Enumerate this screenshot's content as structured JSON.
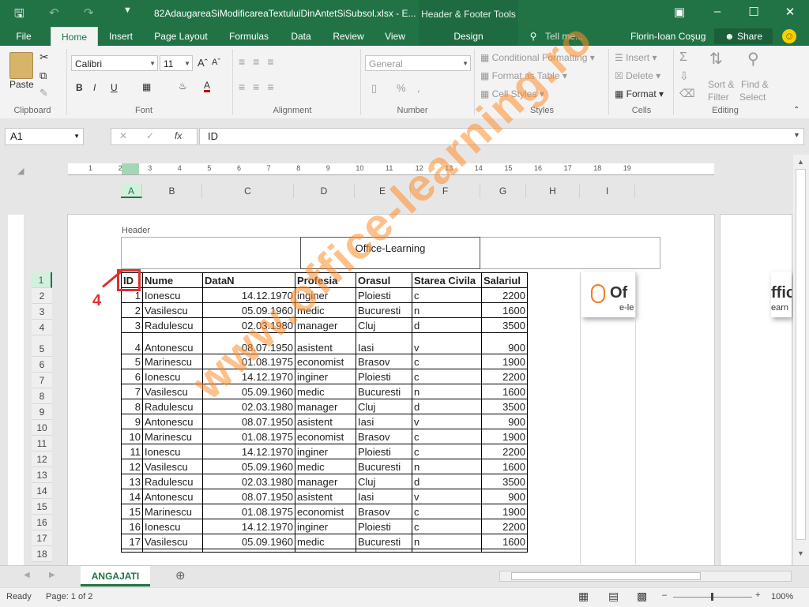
{
  "titlebar": {
    "document_title": "82AdaugareaSiModificareaTextuluiDinAntetSiSubsol.xlsx - E...",
    "context_tools": "Header & Footer Tools"
  },
  "tabs": [
    {
      "label": "File"
    },
    {
      "label": "Home"
    },
    {
      "label": "Insert"
    },
    {
      "label": "Page Layout"
    },
    {
      "label": "Formulas"
    },
    {
      "label": "Data"
    },
    {
      "label": "Review"
    },
    {
      "label": "View"
    },
    {
      "label": "Design"
    },
    {
      "label": "Tell me..."
    }
  ],
  "user": {
    "name": "Florin-Ioan Coşug",
    "share_label": "Share"
  },
  "ribbon": {
    "clipboard": {
      "paste": "Paste",
      "label": "Clipboard"
    },
    "font": {
      "name": "Calibri",
      "size": "11",
      "label": "Font"
    },
    "alignment": {
      "label": "Alignment"
    },
    "number": {
      "format": "General",
      "label": "Number"
    },
    "styles": {
      "conditional": "Conditional Formatting",
      "format_table": "Format as Table",
      "cell_styles": "Cell Styles",
      "label": "Styles"
    },
    "cells": {
      "insert": "Insert",
      "delete": "Delete",
      "format": "Format",
      "label": "Cells"
    },
    "editing": {
      "sort1": "Sort &",
      "sort2": "Filter",
      "find1": "Find &",
      "find2": "Select",
      "label": "Editing"
    }
  },
  "formula_bar": {
    "name_box": "A1",
    "formula": "ID"
  },
  "columns": [
    "A",
    "B",
    "C",
    "D",
    "E",
    "F",
    "G",
    "H",
    "I"
  ],
  "ruler_numbers": [
    "1",
    "2",
    "3",
    "4",
    "5",
    "6",
    "7",
    "8",
    "9",
    "10",
    "11",
    "12",
    "13",
    "14",
    "15",
    "16",
    "17",
    "18",
    "19"
  ],
  "header_area": {
    "label": "Header",
    "center_text": "Office-Learning"
  },
  "table": {
    "headers": [
      "ID",
      "Nume",
      "DataN",
      "Profesia",
      "Orasul",
      "Starea Civila",
      "Salariul"
    ],
    "rows": [
      [
        "1",
        "Ionescu",
        "14.12.1970",
        "inginer",
        "Ploiesti",
        "c",
        "2200"
      ],
      [
        "2",
        "Vasilescu",
        "05.09.1960",
        "medic",
        "Bucuresti",
        "n",
        "1600"
      ],
      [
        "3",
        "Radulescu",
        "02.03.1980",
        "manager",
        "Cluj",
        "d",
        "3500"
      ],
      [
        "4",
        "Antonescu",
        "08.07.1950",
        "asistent",
        "Iasi",
        "v",
        "900"
      ],
      [
        "5",
        "Marinescu",
        "01.08.1975",
        "economist",
        "Brasov",
        "c",
        "1900"
      ],
      [
        "6",
        "Ionescu",
        "14.12.1970",
        "inginer",
        "Ploiesti",
        "c",
        "2200"
      ],
      [
        "7",
        "Vasilescu",
        "05.09.1960",
        "medic",
        "Bucuresti",
        "n",
        "1600"
      ],
      [
        "8",
        "Radulescu",
        "02.03.1980",
        "manager",
        "Cluj",
        "d",
        "3500"
      ],
      [
        "9",
        "Antonescu",
        "08.07.1950",
        "asistent",
        "Iasi",
        "v",
        "900"
      ],
      [
        "10",
        "Marinescu",
        "01.08.1975",
        "economist",
        "Brasov",
        "c",
        "1900"
      ],
      [
        "11",
        "Ionescu",
        "14.12.1970",
        "inginer",
        "Ploiesti",
        "c",
        "2200"
      ],
      [
        "12",
        "Vasilescu",
        "05.09.1960",
        "medic",
        "Bucuresti",
        "n",
        "1600"
      ],
      [
        "13",
        "Radulescu",
        "02.03.1980",
        "manager",
        "Cluj",
        "d",
        "3500"
      ],
      [
        "14",
        "Antonescu",
        "08.07.1950",
        "asistent",
        "Iasi",
        "v",
        "900"
      ],
      [
        "15",
        "Marinescu",
        "01.08.1975",
        "economist",
        "Brasov",
        "c",
        "1900"
      ],
      [
        "16",
        "Ionescu",
        "14.12.1970",
        "inginer",
        "Ploiesti",
        "c",
        "2200"
      ],
      [
        "17",
        "Vasilescu",
        "05.09.1960",
        "medic",
        "Bucuresti",
        "n",
        "1600"
      ]
    ]
  },
  "row_numbers": [
    "1",
    "2",
    "3",
    "4",
    "5",
    "6",
    "7",
    "8",
    "9",
    "10",
    "11",
    "12",
    "13",
    "14",
    "15",
    "16",
    "17",
    "18"
  ],
  "logo_text": {
    "word": "Of",
    "sub": "e-le",
    "word2": "ffic",
    "sub2": "earn"
  },
  "watermark": "www.office-learning.ro",
  "callout": "4",
  "sheet_tab": "ANGAJATI",
  "status": {
    "ready": "Ready",
    "page": "Page: 1 of 2",
    "zoom": "100%"
  },
  "colors": {
    "excel_green": "#217346",
    "callout_red": "#e03030",
    "watermark_orange": "#ff8c28"
  }
}
